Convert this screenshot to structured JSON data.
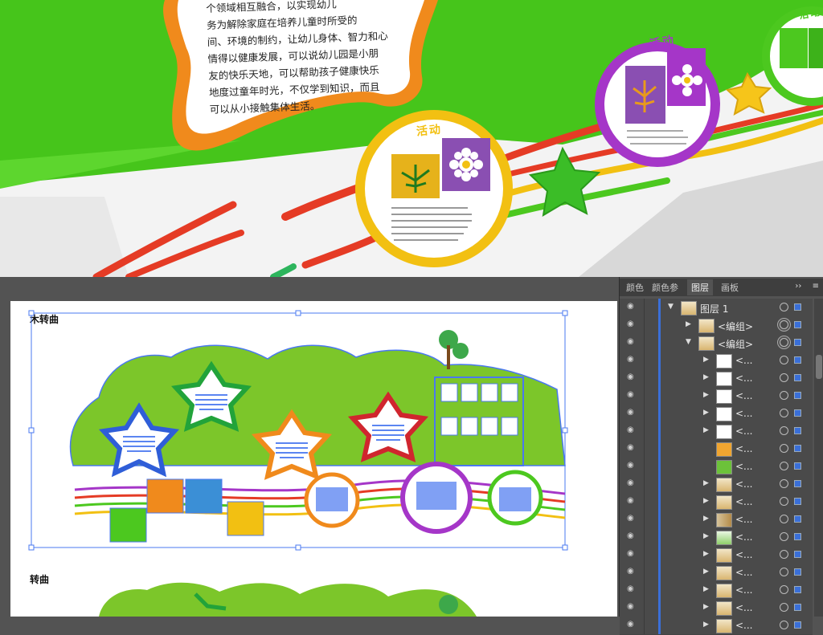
{
  "scene": {
    "intro_lines": [
      "个领域相互融合，以实现幼儿",
      "务为解除家庭在培养儿童时所受的",
      "间、环境的制约，让幼儿身体、智力和心",
      "情得以健康发展，可以说幼儿园是小朋",
      "友的快乐天地，可以帮助孩子健康快乐",
      "地度过童年时光，不仅学到知识，而且",
      "可以从小接触集体生活。"
    ],
    "activity_label": "活动"
  },
  "artboard": {
    "label_top": "木转曲",
    "label_bottom": "转曲"
  },
  "panel": {
    "tabs": [
      "颜色",
      "颜色参",
      "图层",
      "画板"
    ],
    "active_tab": "图层",
    "menu_icon": "››",
    "menu_options_icon": "≡",
    "layers": [
      {
        "name": "图层 1",
        "level": 0,
        "expanded": true,
        "thumb": "scene",
        "target": "single"
      },
      {
        "name": "<编组>",
        "level": 1,
        "expanded": false,
        "thumb": "scene",
        "target": "double"
      },
      {
        "name": "<编组>",
        "level": 1,
        "expanded": true,
        "thumb": "scene",
        "target": "double"
      },
      {
        "name": "<...",
        "level": 2,
        "expanded": false,
        "thumb": "white",
        "target": "single"
      },
      {
        "name": "<...",
        "level": 2,
        "expanded": false,
        "thumb": "white",
        "target": "single"
      },
      {
        "name": "<...",
        "level": 2,
        "expanded": false,
        "thumb": "white",
        "target": "single"
      },
      {
        "name": "<...",
        "level": 2,
        "expanded": false,
        "thumb": "white",
        "target": "single"
      },
      {
        "name": "<...",
        "level": 2,
        "expanded": false,
        "thumb": "white",
        "target": "single"
      },
      {
        "name": "<...",
        "level": 2,
        "expanded": null,
        "thumb": "orange-star",
        "target": "single"
      },
      {
        "name": "<...",
        "level": 2,
        "expanded": null,
        "thumb": "green-star",
        "target": "single"
      },
      {
        "name": "<...",
        "level": 2,
        "expanded": false,
        "thumb": "scene",
        "target": "single"
      },
      {
        "name": "<...",
        "level": 2,
        "expanded": false,
        "thumb": "scene",
        "target": "single"
      },
      {
        "name": "<...",
        "level": 2,
        "expanded": false,
        "thumb": "bar",
        "target": "single"
      },
      {
        "name": "<...",
        "level": 2,
        "expanded": false,
        "thumb": "tree",
        "target": "single"
      },
      {
        "name": "<...",
        "level": 2,
        "expanded": false,
        "thumb": "scene",
        "target": "single"
      },
      {
        "name": "<...",
        "level": 2,
        "expanded": false,
        "thumb": "scene",
        "target": "single"
      },
      {
        "name": "<...",
        "level": 2,
        "expanded": false,
        "thumb": "scene",
        "target": "single"
      },
      {
        "name": "<...",
        "level": 2,
        "expanded": false,
        "thumb": "scene",
        "target": "single"
      },
      {
        "name": "<...",
        "level": 2,
        "expanded": false,
        "thumb": "scene",
        "target": "single"
      }
    ]
  },
  "colors": {
    "panel_bg": "#535353",
    "selection_blue": "#3a6fd8",
    "wall_green": "#4cc81f",
    "orange": "#f08a1c",
    "purple": "#a536c8",
    "yellow": "#f2c012"
  }
}
